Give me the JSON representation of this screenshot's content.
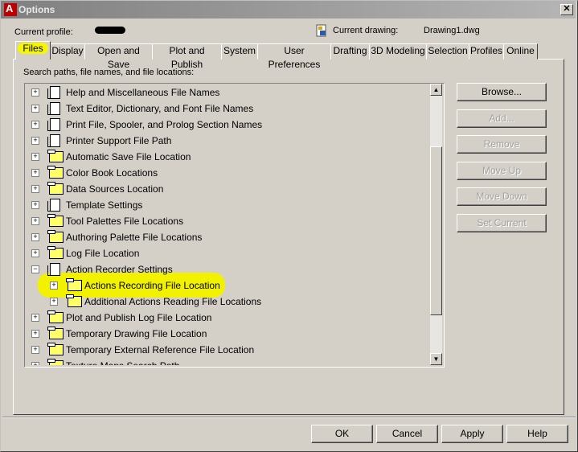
{
  "window": {
    "title": "Options",
    "app_icon_letter": "A",
    "close_glyph": "✕"
  },
  "profile": {
    "label": "Current profile:"
  },
  "drawing": {
    "label": "Current drawing:",
    "value": "Drawing1.dwg"
  },
  "tabs": [
    {
      "label": "Files",
      "active": true
    },
    {
      "label": "Display"
    },
    {
      "label": "Open and Save"
    },
    {
      "label": "Plot and Publish"
    },
    {
      "label": "System"
    },
    {
      "label": "User Preferences"
    },
    {
      "label": "Drafting"
    },
    {
      "label": "3D Modeling"
    },
    {
      "label": "Selection"
    },
    {
      "label": "Profiles"
    },
    {
      "label": "Online"
    }
  ],
  "tree": {
    "heading": "Search paths, file names, and file locations:",
    "items": [
      {
        "label": "Help and Miscellaneous File Names",
        "icon": "document-icon",
        "expander": "+"
      },
      {
        "label": "Text Editor, Dictionary, and Font File Names",
        "icon": "document-icon",
        "expander": "+"
      },
      {
        "label": "Print File, Spooler, and Prolog Section Names",
        "icon": "document-icon",
        "expander": "+"
      },
      {
        "label": "Printer Support File Path",
        "icon": "document-icon",
        "expander": "+"
      },
      {
        "label": "Automatic Save File Location",
        "icon": "folder-icon",
        "expander": "+"
      },
      {
        "label": "Color Book Locations",
        "icon": "folder-icon",
        "expander": "+"
      },
      {
        "label": "Data Sources Location",
        "icon": "folder-icon",
        "expander": "+"
      },
      {
        "label": "Template Settings",
        "icon": "document-icon",
        "expander": "+"
      },
      {
        "label": "Tool Palettes File Locations",
        "icon": "folder-icon",
        "expander": "+"
      },
      {
        "label": "Authoring Palette File Locations",
        "icon": "folder-icon",
        "expander": "+"
      },
      {
        "label": "Log File Location",
        "icon": "folder-icon",
        "expander": "+"
      },
      {
        "label": "Action Recorder Settings",
        "icon": "document-icon",
        "expander": "−"
      },
      {
        "label": "Actions Recording File Location",
        "icon": "folder-icon",
        "expander": "+",
        "highlighted": true
      },
      {
        "label": "Additional Actions Reading File Locations",
        "icon": "folder-icon",
        "expander": "+"
      },
      {
        "label": "Plot and Publish Log File Location",
        "icon": "folder-icon",
        "expander": "+"
      },
      {
        "label": "Temporary Drawing File Location",
        "icon": "folder-icon",
        "expander": "+"
      },
      {
        "label": "Temporary External Reference File Location",
        "icon": "folder-icon",
        "expander": "+"
      },
      {
        "label": "Texture Maps Search Path",
        "icon": "folder-icon",
        "expander": "+"
      }
    ]
  },
  "side_buttons": {
    "browse": "Browse...",
    "add": "Add...",
    "remove": "Remove",
    "move_up": "Move Up",
    "move_down": "Move Down",
    "set_current": "Set Current"
  },
  "scrollbar": {
    "up_glyph": "▲",
    "down_glyph": "▼"
  },
  "footer": {
    "ok": "OK",
    "cancel": "Cancel",
    "apply": "Apply",
    "help": "Help"
  },
  "colors": {
    "highlight": "#f2f200",
    "titlebar": "#808080",
    "dialog": "#d4d0c8"
  }
}
